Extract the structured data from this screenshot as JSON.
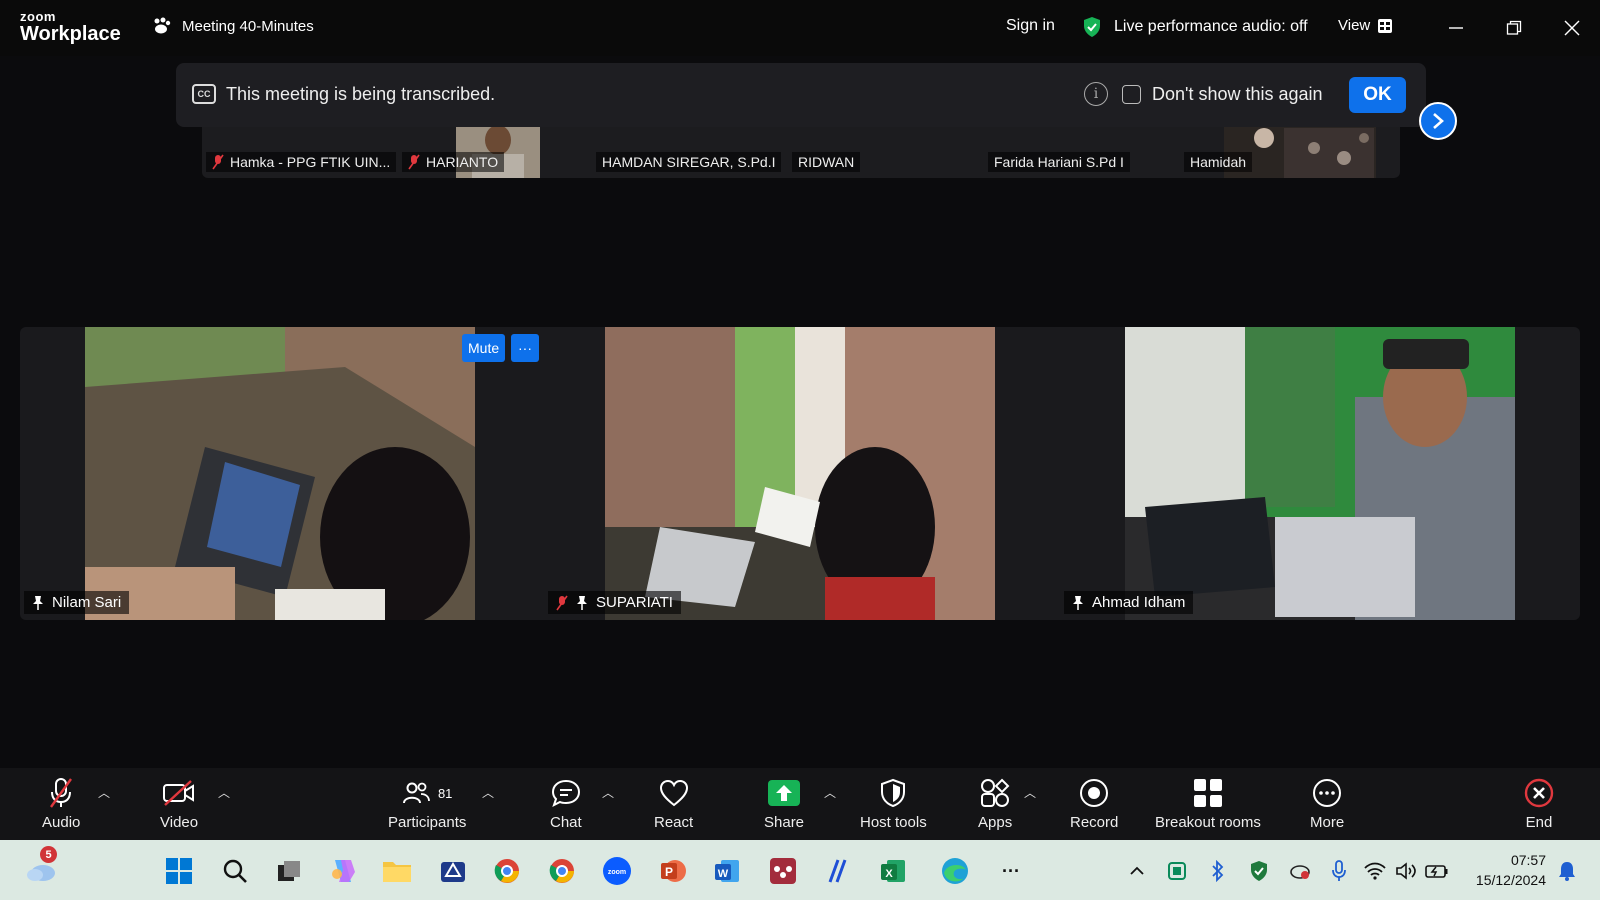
{
  "app": {
    "logo_top": "zoom",
    "logo_bottom": "Workplace",
    "meeting_title": "Meeting 40-Minutes"
  },
  "titlebar": {
    "sign_in": "Sign in",
    "live_performance": "Live performance audio: off",
    "view": "View"
  },
  "banner": {
    "message": "This meeting is being transcribed.",
    "dont_show": "Don't show this again",
    "ok": "OK"
  },
  "strip": {
    "thumbs": [
      {
        "name": "Hamka - PPG FTIK UIN...",
        "cut_label": "Hamka - PPG FT...",
        "muted": true
      },
      {
        "name": "HARIANTO",
        "muted": true
      },
      {
        "name": "HAMDAN SIREGAR, S.Pd.I",
        "cut_label": "HAMDAN SIREGAR",
        "muted": false
      },
      {
        "name": "RIDWAN",
        "cut_label": "RIDWAN",
        "muted": false
      },
      {
        "name": "Farida Hariani S.Pd I",
        "cut_label": "Farida Hariani S.P...",
        "muted": false
      },
      {
        "name": "Hamidah",
        "muted": false
      }
    ]
  },
  "gallery": {
    "tiles": [
      {
        "name": "Nilam Sari"
      },
      {
        "name": "SUPARIATI"
      },
      {
        "name": "Ahmad Idham"
      }
    ],
    "mute": "Mute",
    "more": "···"
  },
  "toolbar": {
    "audio": "Audio",
    "video": "Video",
    "participants": "Participants",
    "participants_count": "81",
    "chat": "Chat",
    "react": "React",
    "share": "Share",
    "host_tools": "Host tools",
    "apps": "Apps",
    "record": "Record",
    "breakout": "Breakout rooms",
    "more": "More",
    "end": "End"
  },
  "taskbar": {
    "weather_badge": "5",
    "time": "07:57",
    "date": "15/12/2024",
    "more": "···"
  },
  "colors": {
    "accent": "#0e71eb",
    "muted_red": "#e0383e",
    "end_red": "#e0383e",
    "share_green": "#17b356"
  }
}
